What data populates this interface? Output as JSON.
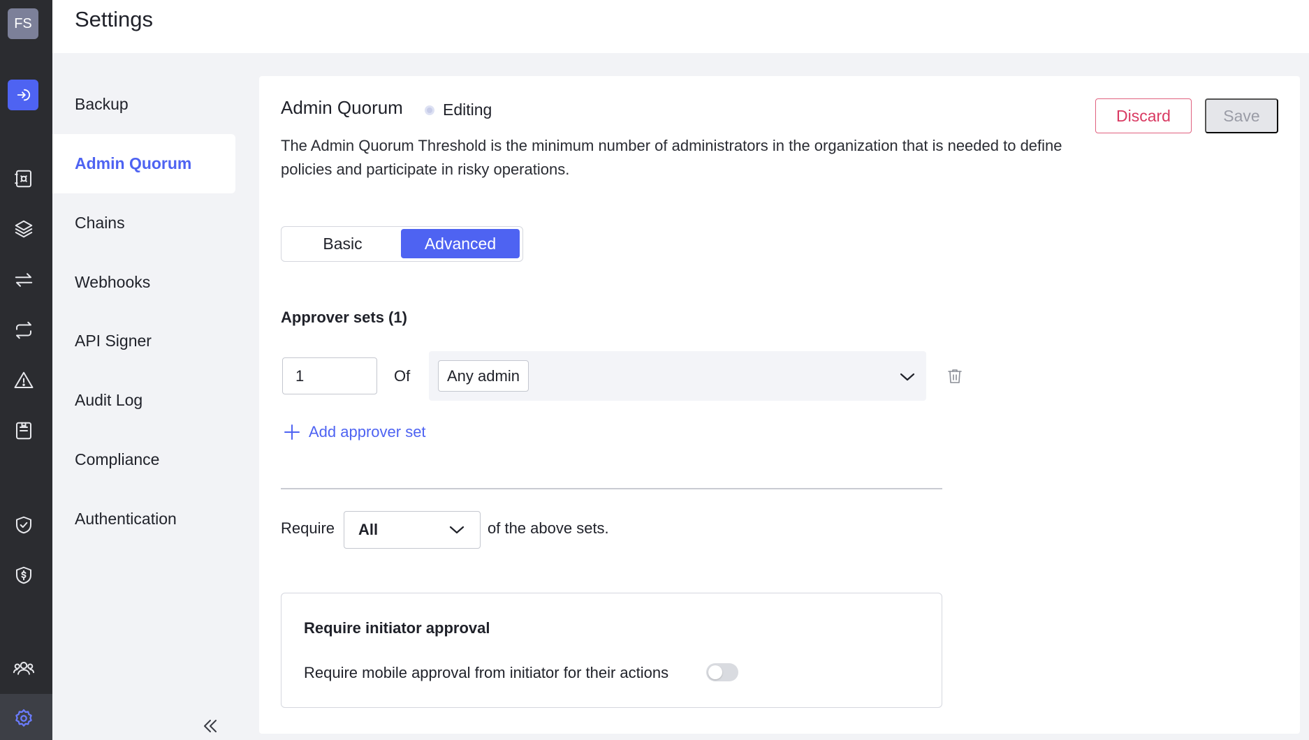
{
  "rail": {
    "avatar_initials": "FS",
    "icons": [
      "login-icon",
      "vault-icon",
      "layers-icon",
      "transfer-icon",
      "repeat-icon",
      "warning-icon",
      "report-icon",
      "shield-check-icon",
      "shield-dollar-icon",
      "users-icon",
      "settings-icon"
    ]
  },
  "header": {
    "title": "Settings"
  },
  "subnav": {
    "items": [
      {
        "label": "Backup"
      },
      {
        "label": "Admin Quorum"
      },
      {
        "label": "Chains"
      },
      {
        "label": "Webhooks"
      },
      {
        "label": "API Signer"
      },
      {
        "label": "Audit Log"
      },
      {
        "label": "Compliance"
      },
      {
        "label": "Authentication"
      }
    ],
    "active": "Admin Quorum"
  },
  "panel": {
    "title": "Admin Quorum",
    "status": "Editing",
    "discard_label": "Discard",
    "save_label": "Save",
    "description": "The Admin Quorum Threshold is the minimum number of administrators in the organization that is needed to define policies and participate in risky operations.",
    "mode_tabs": {
      "basic": "Basic",
      "advanced": "Advanced",
      "selected": "Advanced"
    },
    "approver_sets_title": "Approver sets (1)",
    "approver_set": {
      "count": "1",
      "of_label": "Of",
      "group": "Any admin"
    },
    "add_set_label": "Add approver set",
    "require_label": "Require",
    "require_value": "All",
    "require_suffix": "of the above sets.",
    "initiator": {
      "title": "Require initiator approval",
      "text": "Require mobile approval from initiator for their actions",
      "enabled": false
    }
  },
  "colors": {
    "accent": "#4e63f2",
    "danger": "#d93a62",
    "rail": "#2b2c30"
  }
}
